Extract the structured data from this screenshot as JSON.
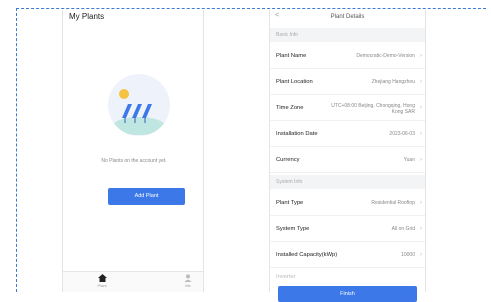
{
  "home": {
    "title": "My Plants",
    "empty_text": "No Plants on the account yet.",
    "add_button": "Add Plant",
    "tabs": [
      {
        "label": "Plant",
        "icon": "home-icon"
      },
      {
        "label": "Me",
        "icon": "user-icon"
      }
    ]
  },
  "details": {
    "back": "<",
    "title": "Plant Details",
    "sections": [
      {
        "label": "Basic Info"
      },
      {
        "label": "System Info"
      }
    ],
    "basic_rows": [
      {
        "label": "Plant Name",
        "value": "Democratic-Demo-Version"
      },
      {
        "label": "Plant Location",
        "value": "Zhejiang Hangzhou"
      },
      {
        "label": "Time Zone",
        "value": "UTC+08:00 Beijing, Chongqing, Hong Kong SAR"
      },
      {
        "label": "Installation Date",
        "value": "2023-06-03"
      },
      {
        "label": "Currency",
        "value": "Yuan"
      }
    ],
    "system_rows": [
      {
        "label": "Plant Type",
        "value": "Residential Rooftop"
      },
      {
        "label": "System Type",
        "value": "All on Grid"
      },
      {
        "label": "Installed Capacity(kWp)",
        "value": "10000"
      },
      {
        "label": "Inverter",
        "value": ""
      }
    ],
    "finish_button": "Finish"
  },
  "colors": {
    "accent": "#3c78e8",
    "guide": "#3a7bd5"
  }
}
